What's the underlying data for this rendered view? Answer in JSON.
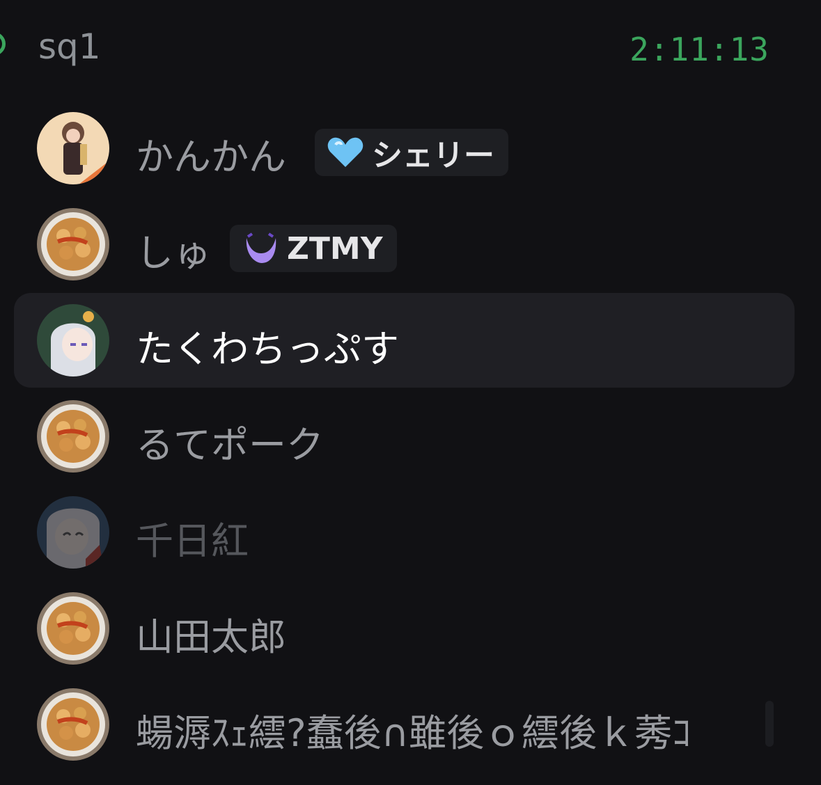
{
  "header": {
    "channel_name": "sq1",
    "timer": "2:11:13"
  },
  "members": [
    {
      "name": "かんかん",
      "tag": "シェリー",
      "tag_icon": "blue-heart-icon",
      "state": "normal"
    },
    {
      "name": "しゅ",
      "tag": "ZTMY",
      "tag_icon": "purple-crescent-icon",
      "state": "normal"
    },
    {
      "name": "たくわちっぷす",
      "state": "speaking"
    },
    {
      "name": "るてポーク",
      "state": "normal"
    },
    {
      "name": "千日紅",
      "state": "muted"
    },
    {
      "name": "山田太郎",
      "state": "normal"
    },
    {
      "name": "蝪溽ｽｪ繧?蠢後∩雖後ｏ繧後ｋ莠ｺ",
      "state": "normal"
    }
  ],
  "colors": {
    "background": "#111114",
    "active_row": "#1f1f24",
    "voice_green": "#3ba55d",
    "name_text": "#9a9ca1",
    "active_name": "#ffffff",
    "tag_bg": "#1e1f23"
  }
}
